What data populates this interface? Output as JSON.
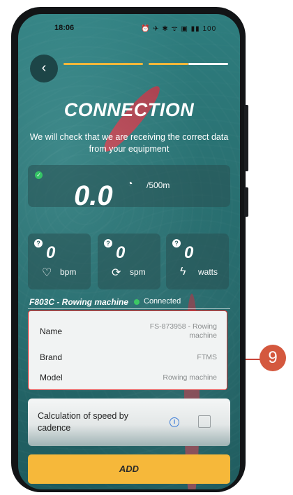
{
  "status_bar": {
    "time": "18:06",
    "icons": "⏰ ✈ ✱ ᯤ ▣ ▮▮ 100"
  },
  "header": {
    "title": "CONNECTION",
    "subtitle": "We will check that we are receiving the correct data from your equipment",
    "progress_steps": 2
  },
  "speed": {
    "value": "0.0",
    "unit": "/500m"
  },
  "metrics": [
    {
      "value": "0",
      "unit": "bpm",
      "icon": "heart-icon"
    },
    {
      "value": "0",
      "unit": "spm",
      "icon": "refresh-icon"
    },
    {
      "value": "0",
      "unit": "watts",
      "icon": "lightning-icon"
    }
  ],
  "device": {
    "name": "F803C - Rowing machine",
    "status": "Connected"
  },
  "info": {
    "name_label": "Name",
    "name_value": "FS-873958 - Rowing machine",
    "brand_label": "Brand",
    "brand_value": "FTMS",
    "model_label": "Model",
    "model_value": "Rowing machine"
  },
  "calc": {
    "label": "Calculation of speed by cadence",
    "checked": false
  },
  "add_button": {
    "label": "ADD"
  },
  "annotation": {
    "number": "9"
  },
  "colors": {
    "accent": "#f6b83a",
    "connected": "#3cc864",
    "callout": "#d4583e"
  }
}
